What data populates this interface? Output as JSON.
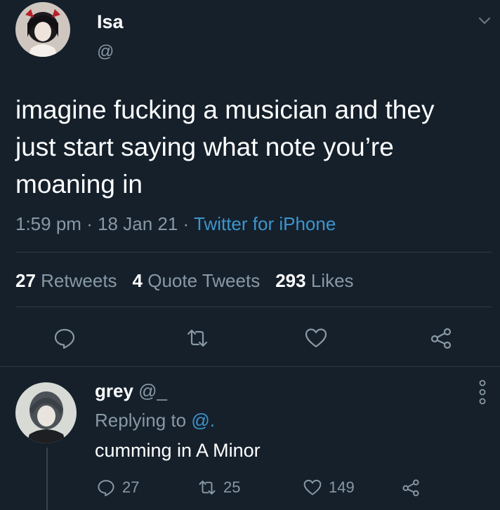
{
  "tweet": {
    "author_name": "Isa",
    "author_handle": "@",
    "text": "imagine fucking a musician and they just start saying what note you’re moaning in",
    "time": "1:59 pm",
    "date": "18 Jan 21",
    "source": "Twitter for iPhone",
    "separator": "·"
  },
  "stats": {
    "retweets_count": "27",
    "retweets_label": "Retweets",
    "quotes_count": "4",
    "quotes_label": "Quote Tweets",
    "likes_count": "293",
    "likes_label": "Likes"
  },
  "actions": [
    "comment-icon",
    "retweet-icon",
    "heart-icon",
    "share-icon"
  ],
  "reply": {
    "author_name": "grey",
    "author_handle": "@_",
    "replying_label": "Replying to",
    "replying_handle": "@.",
    "text": "cumming in A Minor",
    "replies": "27",
    "retweets": "25",
    "likes": "149"
  },
  "colors": {
    "background": "#15202b",
    "secondary_text": "#8899a6",
    "link": "#3d95ce",
    "divider": "#2c3a47"
  }
}
